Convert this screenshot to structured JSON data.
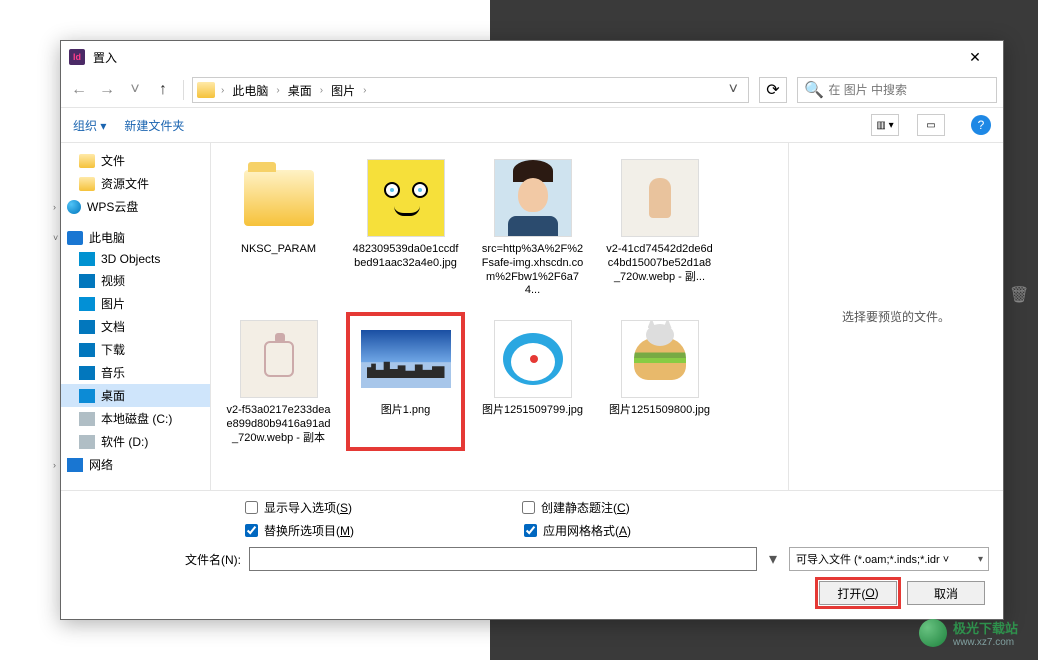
{
  "dialog": {
    "title": "置入",
    "close": "✕"
  },
  "nav": {
    "back": "←",
    "fwd": "→",
    "up": "↑",
    "refresh": "⟳",
    "dropdown": "˅"
  },
  "breadcrumb": {
    "items": [
      "此电脑",
      "桌面",
      "图片"
    ],
    "sep": "›"
  },
  "search": {
    "icon": "🔍",
    "placeholder": "在 图片 中搜索"
  },
  "toolbar": {
    "organize": "组织 ▾",
    "newfolder": "新建文件夹",
    "view_icon": "▥ ▾",
    "preview_icon": "▭",
    "help": "?"
  },
  "tree": [
    {
      "lv": 1,
      "icon": "ico-folder",
      "label": "文件"
    },
    {
      "lv": 1,
      "icon": "ico-folder",
      "label": "资源文件"
    },
    {
      "lv": 0,
      "icon": "ico-wps",
      "label": "WPS云盘",
      "exp": "›"
    },
    {
      "lv": 0,
      "icon": "ico-pc",
      "label": "此电脑",
      "exp": "˅"
    },
    {
      "lv": 1,
      "icon": "ico-3d",
      "label": "3D Objects"
    },
    {
      "lv": 1,
      "icon": "ico-video",
      "label": "视频"
    },
    {
      "lv": 1,
      "icon": "ico-pic",
      "label": "图片"
    },
    {
      "lv": 1,
      "icon": "ico-doc",
      "label": "文档"
    },
    {
      "lv": 1,
      "icon": "ico-dl",
      "label": "下载"
    },
    {
      "lv": 1,
      "icon": "ico-music",
      "label": "音乐"
    },
    {
      "lv": 1,
      "icon": "ico-desk",
      "label": "桌面",
      "sel": true
    },
    {
      "lv": 1,
      "icon": "ico-disk",
      "label": "本地磁盘 (C:)"
    },
    {
      "lv": 1,
      "icon": "ico-disk",
      "label": "软件 (D:)"
    },
    {
      "lv": 0,
      "icon": "ico-net",
      "label": "网络",
      "exp": "›"
    }
  ],
  "files": [
    {
      "type": "folder",
      "label": "NKSC_PARAM"
    },
    {
      "type": "sponge",
      "label": "482309539da0e1ccdfbed91aac32a4e0.jpg"
    },
    {
      "type": "portrait",
      "label": "src=http%3A%2F%2Fsafe-img.xhscdn.com%2Fbw1%2F6a74..."
    },
    {
      "type": "swing",
      "label": "v2-41cd74542d2de6dc4bd15007be52d1a8_720w.webp - 副..."
    },
    {
      "type": "perfume",
      "label": "v2-f53a0217e233deae899d80b9416a91ad_720w.webp - 副本"
    },
    {
      "type": "city",
      "label": "图片1.png",
      "selected": true
    },
    {
      "type": "dora",
      "label": "图片1251509799.jpg"
    },
    {
      "type": "burger",
      "label": "图片1251509800.jpg"
    }
  ],
  "preview": {
    "message": "选择要预览的文件。"
  },
  "options": {
    "show_import": {
      "label": "显示导入选项(",
      "u": "S",
      "tail": ")",
      "checked": false
    },
    "create_caption": {
      "label": "创建静态题注(",
      "u": "C",
      "tail": ")",
      "checked": false
    },
    "replace_sel": {
      "label": "替换所选项目(",
      "u": "M",
      "tail": ")",
      "checked": true
    },
    "apply_grid": {
      "label": "应用网格格式(",
      "u": "A",
      "tail": ")",
      "checked": true
    }
  },
  "filename": {
    "label": "文件名(",
    "u": "N",
    "tail": "):",
    "value": "",
    "filter": "可导入文件 (*.oam;*.inds;*.idr ˅"
  },
  "buttons": {
    "open": "打开(",
    "open_u": "O",
    "open_tail": ")",
    "cancel": "取消"
  },
  "watermark": {
    "name": "极光下载站",
    "url": "www.xz7.com"
  },
  "trash_icon": "🗑"
}
